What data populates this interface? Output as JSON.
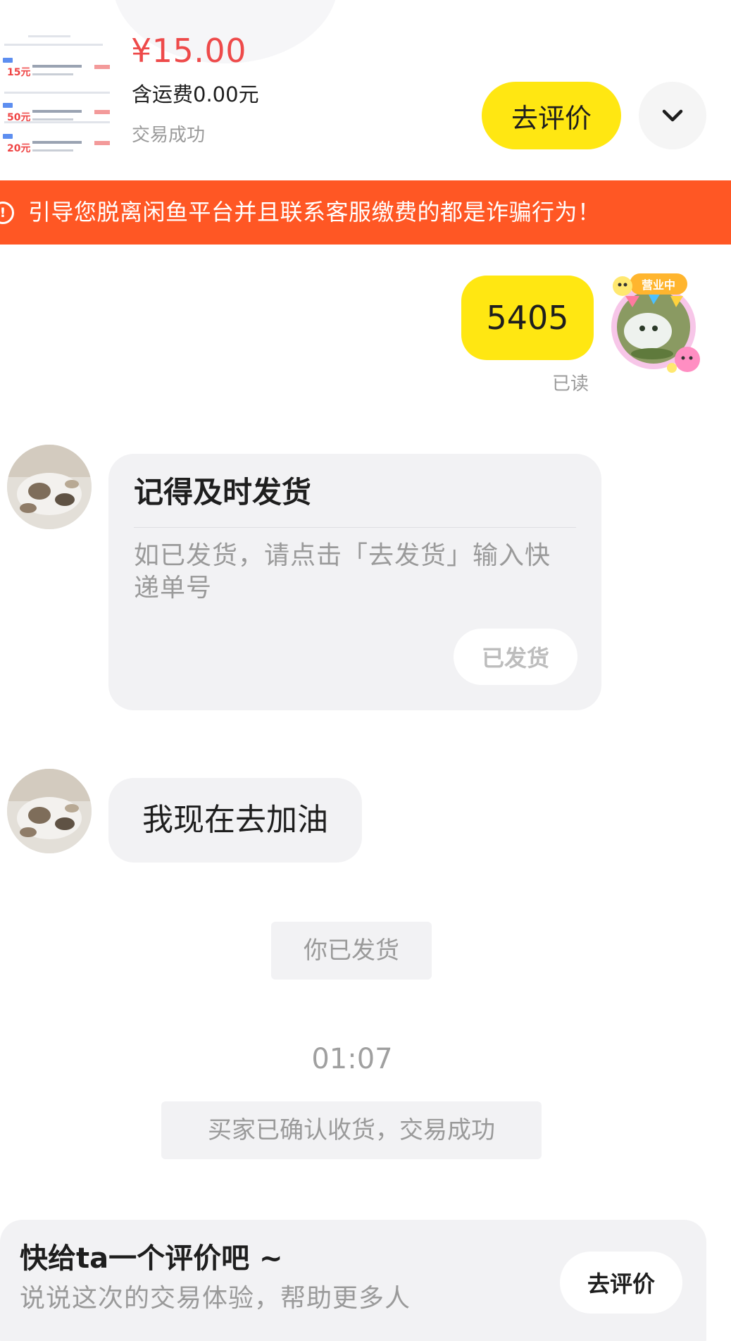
{
  "order": {
    "price": "¥15.00",
    "shipping": "含运费0.00元",
    "status": "交易成功",
    "review_button": "去评价",
    "expand_icon": "chevron-down-icon",
    "thumbnail_amounts": [
      "15元",
      "50元",
      "20元"
    ]
  },
  "warning": {
    "icon": "exclamation-circle-icon",
    "text": "引导您脱离闲鱼平台并且联系客服缴费的都是诈骗行为！"
  },
  "messages": {
    "self_message": "5405",
    "read_status": "已读",
    "self_avatar_badge": "营业中",
    "reminder_card": {
      "title": "记得及时发货",
      "body": "如已发货，请点击「去发货」输入快递单号",
      "button": "已发货"
    },
    "other_message": "我现在去加油"
  },
  "system": {
    "shipped": "你已发货",
    "timestamp": "01:07",
    "confirmed": "买家已确认收货，交易成功"
  },
  "review_prompt": {
    "title": "快给ta一个评价吧 ~",
    "subtitle": "说说这次的交易体验，帮助更多人",
    "button": "去评价"
  },
  "colors": {
    "accent_yellow": "#ffe712",
    "price_red": "#ee4a4a",
    "warning_orange": "#ff5724",
    "bubble_gray": "#f2f2f4",
    "muted_text": "#9a9a9a"
  }
}
